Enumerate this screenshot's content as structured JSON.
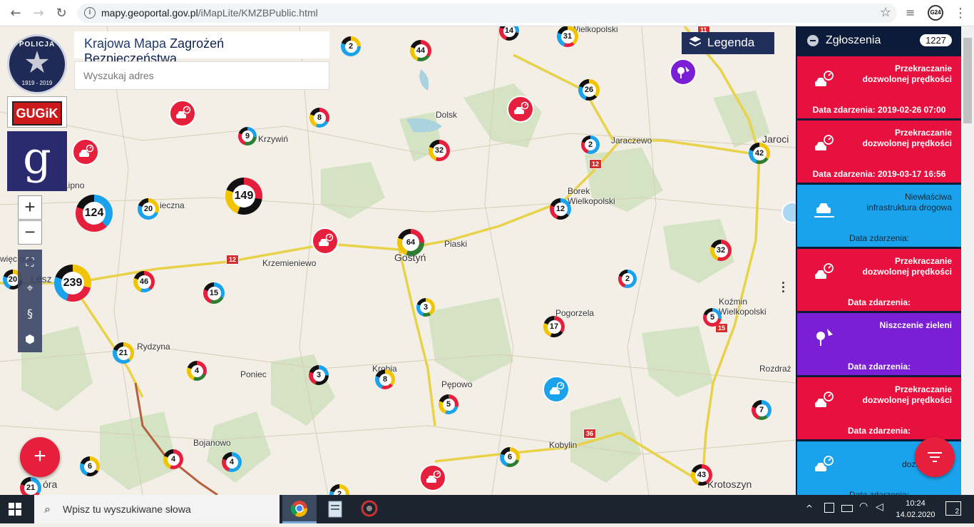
{
  "browser": {
    "url_host": "mapy.geoportal.gov.pl",
    "url_path": "/iMapLite/KMZBPublic.html",
    "badge": "G24"
  },
  "app": {
    "title_plain": "Krajowa Mapa ",
    "title_bold": "Zagrożeń Bezpieczeństwa",
    "search_placeholder": "Wyszukaj adres",
    "legend_label": "Legenda",
    "logo_policja_text": "POLICJA",
    "logo_policja_years": "1919 - 2019",
    "logo_gugik_text": "GUGiK",
    "logo_g_text": "g",
    "zoom_in": "+",
    "zoom_out": "−",
    "add_label": "+",
    "colors": {
      "red": "#e6203c",
      "blue": "#1aa3ec",
      "purple": "#7a1fd6",
      "navy": "#0d1b3a"
    }
  },
  "map": {
    "towns": [
      {
        "name": "Wielkopolski",
        "big": false
      },
      {
        "name": "Dolsk",
        "big": false
      },
      {
        "name": "Krzywiń",
        "big": false
      },
      {
        "name": "Jaraczewo",
        "big": false
      },
      {
        "name": "Jaroci",
        "big": true
      },
      {
        "name": "Lipno",
        "big": false
      },
      {
        "name": "Borek",
        "big": false
      },
      {
        "name": "Wielkopolski",
        "big": false
      },
      {
        "name": "ieczna",
        "big": false
      },
      {
        "name": "Piaski",
        "big": false
      },
      {
        "name": "Gostyń",
        "big": true
      },
      {
        "name": "Krzemieniewo",
        "big": false
      },
      {
        "name": "więc owa",
        "big": false
      },
      {
        "name": "Lesz",
        "big": true
      },
      {
        "name": "Koźmin",
        "big": false
      },
      {
        "name": "Wielkopolski",
        "big": false
      },
      {
        "name": "Pogorzela",
        "big": false
      },
      {
        "name": "Rydzyna",
        "big": false
      },
      {
        "name": "Krobia",
        "big": false
      },
      {
        "name": "Poniec",
        "big": false
      },
      {
        "name": "Pępowo",
        "big": false
      },
      {
        "name": "Rozdraż",
        "big": false
      },
      {
        "name": "Bojanowo",
        "big": false
      },
      {
        "name": "Kobylin",
        "big": false
      },
      {
        "name": "Krotoszyn",
        "big": true
      },
      {
        "name": "óra",
        "big": true
      }
    ],
    "road_numbers": [
      "12",
      "12",
      "15",
      "36",
      "11"
    ],
    "clusters": [
      "2",
      "44",
      "14",
      "31",
      "8",
      "9",
      "26",
      "32",
      "2",
      "42",
      "149",
      "124",
      "20",
      "64",
      "12",
      "239",
      "46",
      "15",
      "20",
      "32",
      "2",
      "3",
      "17",
      "5",
      "21",
      "4",
      "3",
      "8",
      "5",
      "7",
      "6",
      "4",
      "4",
      "6",
      "43",
      "21",
      "2"
    ],
    "incident_markers": [
      {
        "type": "speed",
        "color": "red"
      },
      {
        "type": "speed",
        "color": "red"
      },
      {
        "type": "speed",
        "color": "red"
      },
      {
        "type": "speed",
        "color": "red"
      },
      {
        "type": "speed",
        "color": "blue"
      },
      {
        "type": "speed",
        "color": "red"
      },
      {
        "type": "greenery",
        "color": "purple"
      }
    ]
  },
  "panel": {
    "title": "Zgłoszenia",
    "count": "1227",
    "reports": [
      {
        "category_line1": "Przekraczanie",
        "category_line2": "dozwolonej prędkości",
        "date": "Data zdarzenia: 2019-02-26 07:00",
        "color": "red",
        "icon": "speed-car-icon"
      },
      {
        "category_line1": "Przekraczanie",
        "category_line2": "dozwolonej prędkości",
        "date": "Data zdarzenia: 2019-03-17 16:56",
        "color": "red",
        "icon": "speed-car-icon"
      },
      {
        "category_line1": "Niewłaściwa",
        "category_line2": "infrastruktura drogowa",
        "date": "Data zdarzenia:",
        "color": "blue",
        "icon": "road-infrastructure-icon"
      },
      {
        "category_line1": "Przekraczanie",
        "category_line2": "dozwolonej prędkości",
        "date": "Data zdarzenia:",
        "color": "red",
        "icon": "speed-car-icon"
      },
      {
        "category_line1": "Niszczenie zieleni",
        "category_line2": "",
        "date": "Data zdarzenia:",
        "color": "purple",
        "icon": "greenery-damage-icon"
      },
      {
        "category_line1": "Przekraczanie",
        "category_line2": "dozwolonej prędkości",
        "date": "Data zdarzenia:",
        "color": "red",
        "icon": "speed-car-icon"
      },
      {
        "category_line1": "Przek",
        "category_line2": "dozwolonej p",
        "date": "Data zdarzenia:",
        "color": "blue",
        "icon": "speed-car-icon"
      }
    ]
  },
  "taskbar": {
    "search_placeholder": "Wpisz tu wyszukiwane słowa",
    "time": "10:24",
    "date": "14.02.2020",
    "notification_count": "2"
  }
}
